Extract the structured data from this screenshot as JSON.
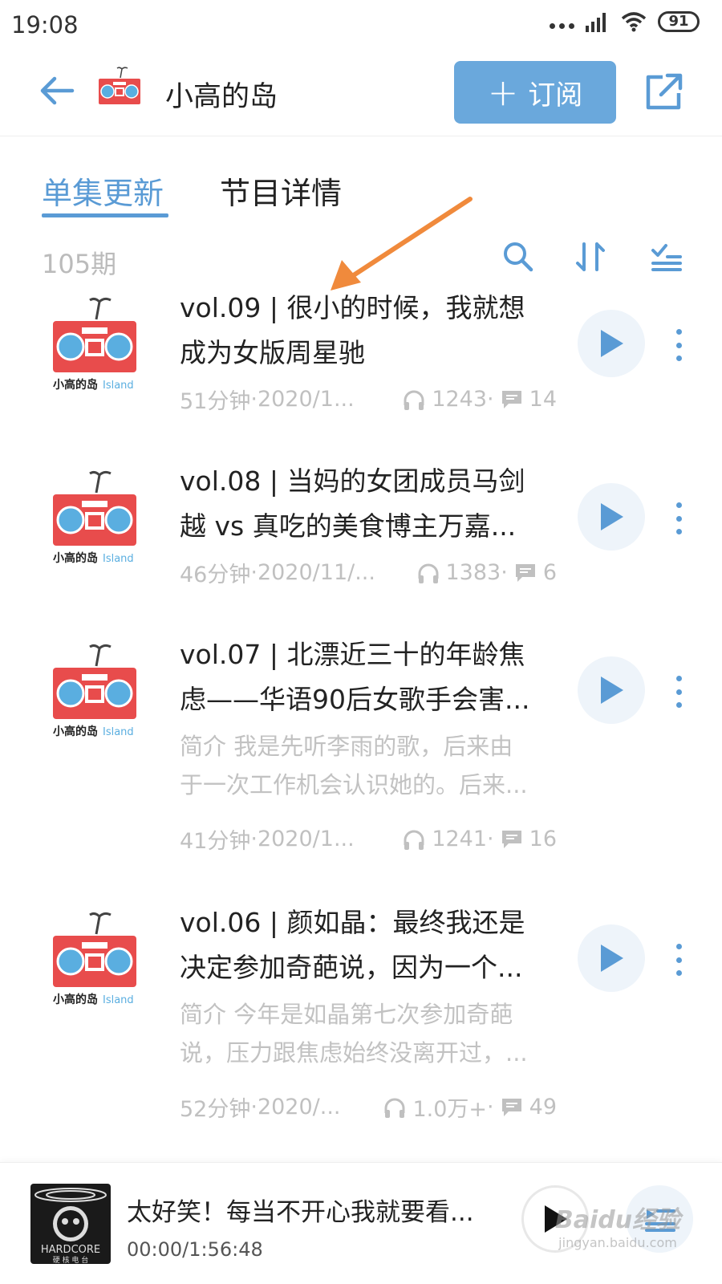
{
  "status_bar": {
    "time": "19:08",
    "battery": "91"
  },
  "header": {
    "title": "小高的岛",
    "subscribe_label": "订阅",
    "subscribe_plus": "+"
  },
  "tabs": [
    {
      "label": "单集更新",
      "active": true
    },
    {
      "label": "节目详情",
      "active": false
    }
  ],
  "list": {
    "episode_count": "105期"
  },
  "episodes": [
    {
      "title": "vol.09 | 很小的时候，我就想成为女版周星驰",
      "title_line1": "vol.09 | 很小的时候，我就想",
      "title_line2": "成为女版周星驰",
      "desc_line1": "",
      "desc_line2": "",
      "duration": "51分钟",
      "date": "2020/1...",
      "plays": "1243",
      "comments": "14"
    },
    {
      "title": "vol.08 | 当妈的女团成员马剑越 vs 真吃的美食博主万嘉...",
      "title_line1": "vol.08 | 当妈的女团成员马剑",
      "title_line2": "越 vs 真吃的美食博主万嘉...",
      "desc_line1": "",
      "desc_line2": "",
      "duration": "46分钟",
      "date": "2020/11/...",
      "plays": "1383",
      "comments": "6"
    },
    {
      "title": "vol.07 | 北漂近三十的年龄焦虑——华语90后女歌手会害...",
      "title_line1": "vol.07 | 北漂近三十的年龄焦",
      "title_line2": "虑——华语90后女歌手会害...",
      "desc_line1": "简介 我是先听李雨的歌，后来由",
      "desc_line2": "于一次工作机会认识她的。后来...",
      "duration": "41分钟",
      "date": "2020/1...",
      "plays": "1241",
      "comments": "16"
    },
    {
      "title": "vol.06 | 颜如晶：最终我还是决定参加奇葩说，因为一个...",
      "title_line1": "vol.06 | 颜如晶：最终我还是",
      "title_line2": "决定参加奇葩说，因为一个...",
      "desc_line1": "简介 今年是如晶第七次参加奇葩",
      "desc_line2": "说，压力跟焦虑始终没离开过，...",
      "duration": "52分钟",
      "date": "2020/...",
      "plays": "1.0万+",
      "comments": "49"
    }
  ],
  "cover": {
    "brand_text": "小高的岛",
    "brand_en": "Island"
  },
  "mini_player": {
    "title": "太好笑！每当不开心我就要看...",
    "time": "00:00/1:56:48",
    "cover_text": "HARDCORE",
    "cover_sub": "硬 核 电 台"
  },
  "watermark": {
    "top": "Baidu经验",
    "bottom": "jingyan.baidu.com"
  },
  "colors": {
    "accent": "#5a9bd5",
    "subscribe_bg": "#6aa8dc",
    "arrow": "#f08a3c",
    "cover_red": "#e84c4c",
    "cover_blue": "#5aaee0"
  }
}
